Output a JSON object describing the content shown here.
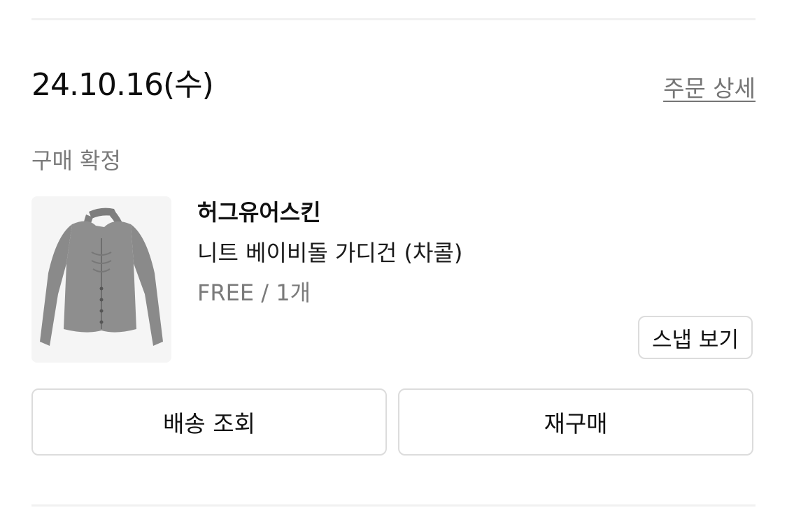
{
  "order": {
    "date": "24.10.16(수)",
    "detail_link": "주문 상세",
    "status": "구매 확정"
  },
  "product": {
    "brand": "허그유어스킨",
    "name": "니트 베이비돌 가디건 (차콜)",
    "option": "FREE / 1개",
    "image_icon": "cardigan-image",
    "snap_button_label": "스냅 보기"
  },
  "actions": {
    "track_shipping_label": "배송 조회",
    "reorder_label": "재구매"
  },
  "colors": {
    "text_primary": "#111111",
    "text_secondary": "#7a7a7a",
    "border": "#dcdcdc",
    "divider": "#f1f1f1",
    "garment": "#8c8c8c"
  }
}
